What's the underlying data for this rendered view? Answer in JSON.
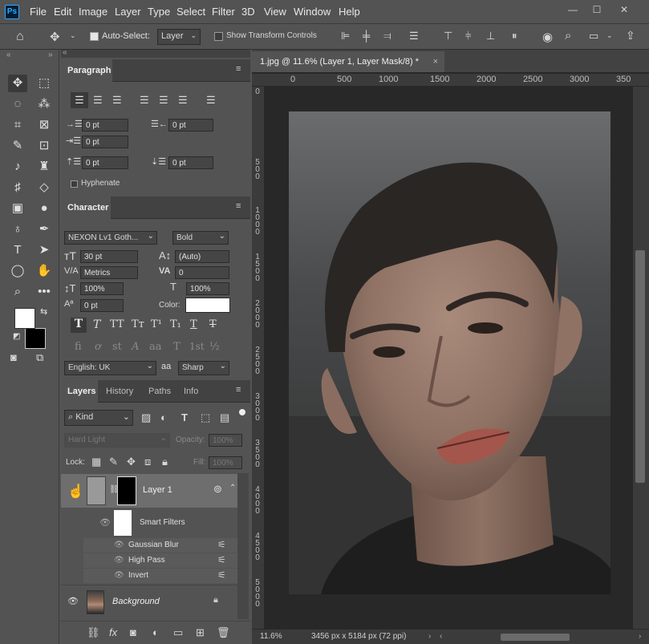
{
  "app": {
    "logo": "Ps",
    "menu": [
      "File",
      "Edit",
      "Image",
      "Layer",
      "Type",
      "Select",
      "Filter",
      "3D",
      "View",
      "Window",
      "Help"
    ],
    "window_controls": [
      "—",
      "☐",
      "✕"
    ]
  },
  "options_bar": {
    "auto_select_label": "Auto-Select:",
    "auto_select_checked": true,
    "auto_select_target": "Layer",
    "show_transform_label": "Show Transform Controls",
    "show_transform_checked": false
  },
  "paragraph_panel": {
    "tab": "Paragraph",
    "indent_left": "0 pt",
    "indent_right": "0 pt",
    "indent_first": "0 pt",
    "space_before": "0 pt",
    "space_after": "0 pt",
    "hyphenate_label": "Hyphenate"
  },
  "character_panel": {
    "tab": "Character",
    "font_family": "NEXON Lv1 Goth...",
    "font_style": "Bold",
    "font_size": "30 pt",
    "leading": "(Auto)",
    "kerning": "Metrics",
    "tracking": "0",
    "vertical_scale": "100%",
    "horizontal_scale": "100%",
    "baseline_shift": "0 pt",
    "color_label": "Color:",
    "language": "English: UK",
    "antialias_icon": "aa",
    "antialias": "Sharp",
    "style_buttons": [
      "T",
      "T",
      "TT",
      "Tт",
      "T¹",
      "T₁",
      "T",
      "T"
    ],
    "opentype_buttons": [
      "fi",
      "ơ",
      "st",
      "A",
      "aa",
      "T",
      "1st",
      "½"
    ]
  },
  "layers_panel": {
    "tabs": [
      "Layers",
      "History",
      "Paths",
      "Info"
    ],
    "filter_kind": "Kind",
    "blend_mode": "Hard Light",
    "opacity_label": "Opacity:",
    "opacity": "100%",
    "lock_label": "Lock:",
    "fill_label": "Fill:",
    "fill": "100%",
    "layers": [
      {
        "name": "Layer 1"
      },
      {
        "name": "Smart Filters"
      },
      {
        "name": "Gaussian Blur"
      },
      {
        "name": "High Pass"
      },
      {
        "name": "Invert"
      },
      {
        "name": "Background"
      }
    ]
  },
  "document": {
    "tab_title": "1.jpg @ 11.6% (Layer 1, Layer Mask/8) *",
    "ruler_top": [
      "0",
      "500",
      "1000",
      "1500",
      "2000",
      "2500",
      "3000",
      "350"
    ],
    "ruler_left": [
      "0",
      "5\n0\n0",
      "1\n0\n0\n0",
      "1\n5\n0\n0",
      "2\n0\n0\n0",
      "2\n5\n0\n0",
      "3\n0\n0\n0",
      "3\n5\n0\n0",
      "4\n0\n0\n0",
      "4\n5\n0\n0",
      "5\n0\n0\n0"
    ],
    "zoom": "11.6%",
    "dimensions": "3456 px x 5184 px (72 ppi)"
  },
  "colors": {
    "foreground": "#ffffff",
    "background": "#000000",
    "accent": "#31a8ff"
  }
}
